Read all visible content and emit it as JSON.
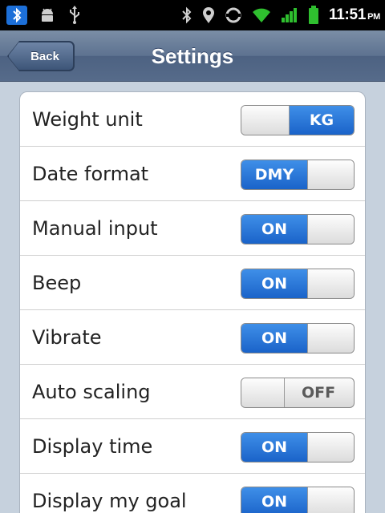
{
  "status_bar": {
    "icons": [
      "bluetooth-notification-icon",
      "android-debug-icon",
      "usb-icon",
      "bluetooth-icon",
      "gps-icon",
      "sync-icon",
      "wifi-icon",
      "signal-icon",
      "battery-icon"
    ],
    "time": "11:51",
    "ampm": "PM"
  },
  "header": {
    "back_label": "Back",
    "title": "Settings"
  },
  "settings": [
    {
      "label": "Weight unit",
      "value": "KG",
      "state": "on-right"
    },
    {
      "label": "Date format",
      "value": "DMY",
      "state": "on-left"
    },
    {
      "label": "Manual input",
      "value": "ON",
      "state": "on-left"
    },
    {
      "label": "Beep",
      "value": "ON",
      "state": "on-left"
    },
    {
      "label": "Vibrate",
      "value": "ON",
      "state": "on-left"
    },
    {
      "label": "Auto scaling",
      "value": "OFF",
      "state": "off"
    },
    {
      "label": "Display time",
      "value": "ON",
      "state": "on-left"
    },
    {
      "label": "Display my goal",
      "value": "ON",
      "state": "on-left"
    }
  ],
  "colors": {
    "accent": "#1a63c9",
    "header": "#5d7290",
    "background": "#c6d1dd"
  }
}
